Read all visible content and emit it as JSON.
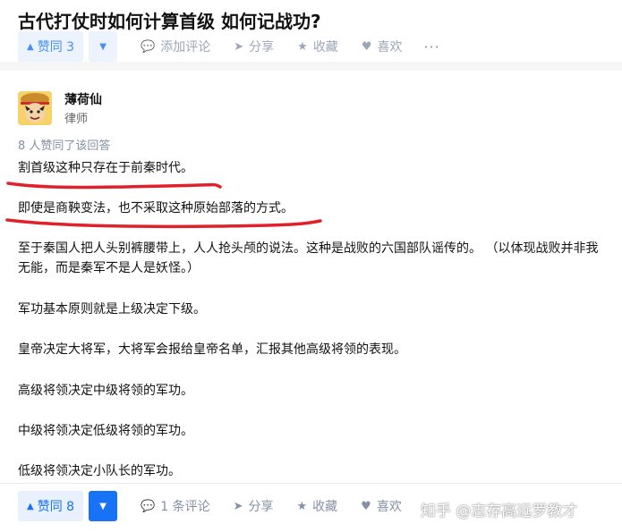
{
  "question": {
    "title": "古代打仗时如何计算首级 如何记战功?"
  },
  "top_actions": {
    "upvote_label": "赞同 3",
    "comment_label": "添加评论",
    "share_label": "分享",
    "collect_label": "收藏",
    "like_label": "喜欢",
    "more_label": "···"
  },
  "author": {
    "name": "薄荷仙",
    "title": "律师"
  },
  "answer": {
    "upvote_note": "8 人赞同了该回答",
    "paragraphs": [
      "割首级这种只存在于前秦时代。",
      "即使是商鞅变法，也不采取这种原始部落的方式。",
      "至于秦国人把人头别裤腰带上，人人抢头颅的说法。这种是战败的六国部队谣传的。 （以体现战败并非我无能，而是秦军不是人是妖怪。）",
      "军功基本原则就是上级决定下级。",
      "皇帝决定大将军，大将军会报给皇帝名单，汇报其他高级将领的表现。",
      "高级将领决定中级将领的军功。",
      "中级将领决定低级将领的军功。",
      "低级将领决定小队长的军功。"
    ]
  },
  "bottom_actions": {
    "upvote_label": "赞同 8",
    "comment_label": "1 条评论",
    "share_label": "分享",
    "collect_label": "收藏",
    "like_label": "喜欢",
    "more_label": "···"
  },
  "watermark": "知乎 @志存高远罗教才",
  "colors": {
    "accent": "#1772f6",
    "accent_bg": "#e8f1fd",
    "muted": "#8590a6",
    "annotation_red": "#e0202a"
  }
}
